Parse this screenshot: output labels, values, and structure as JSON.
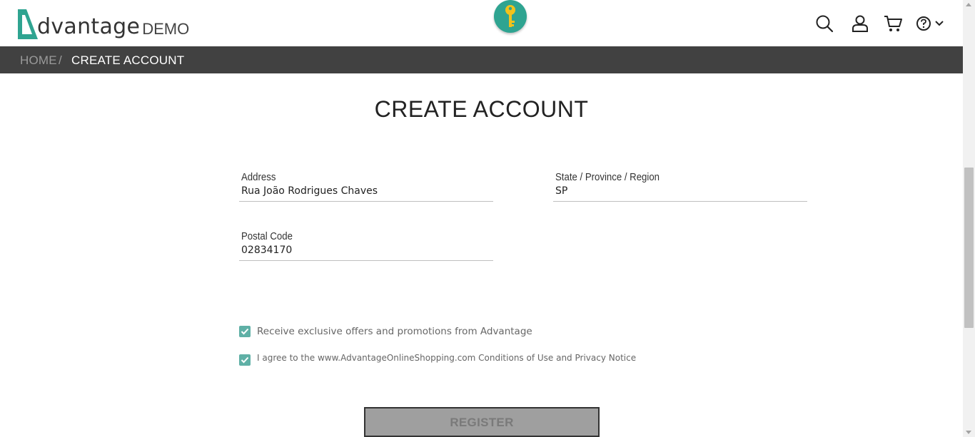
{
  "brand": {
    "word": "dvantage",
    "demo": "DEMO",
    "accent": "#2fa491"
  },
  "header_icons": [
    "search-icon",
    "user-icon",
    "cart-icon",
    "help-icon",
    "chevron-down-icon"
  ],
  "breadcrumb": {
    "home": "HOME",
    "separator": "/",
    "current": "CREATE ACCOUNT"
  },
  "page": {
    "title": "CREATE ACCOUNT"
  },
  "form": {
    "address": {
      "label": "Address",
      "value": "Rua João Rodrigues Chaves"
    },
    "state": {
      "label": "State / Province / Region",
      "value": "SP"
    },
    "postal": {
      "label": "Postal Code",
      "value": "02834170"
    }
  },
  "checkboxes": {
    "offers": {
      "label": "Receive exclusive offers and promotions from Advantage",
      "checked": true
    },
    "agree": {
      "label": "I agree to the www.AdvantageOnlineShopping.com Conditions of Use and Privacy Notice",
      "checked": true
    }
  },
  "register_label": "REGISTER",
  "colors": {
    "breadcrumb_bg": "#414141",
    "checkbox": "#5fb0a6",
    "button_bg": "#9f9f9f"
  }
}
